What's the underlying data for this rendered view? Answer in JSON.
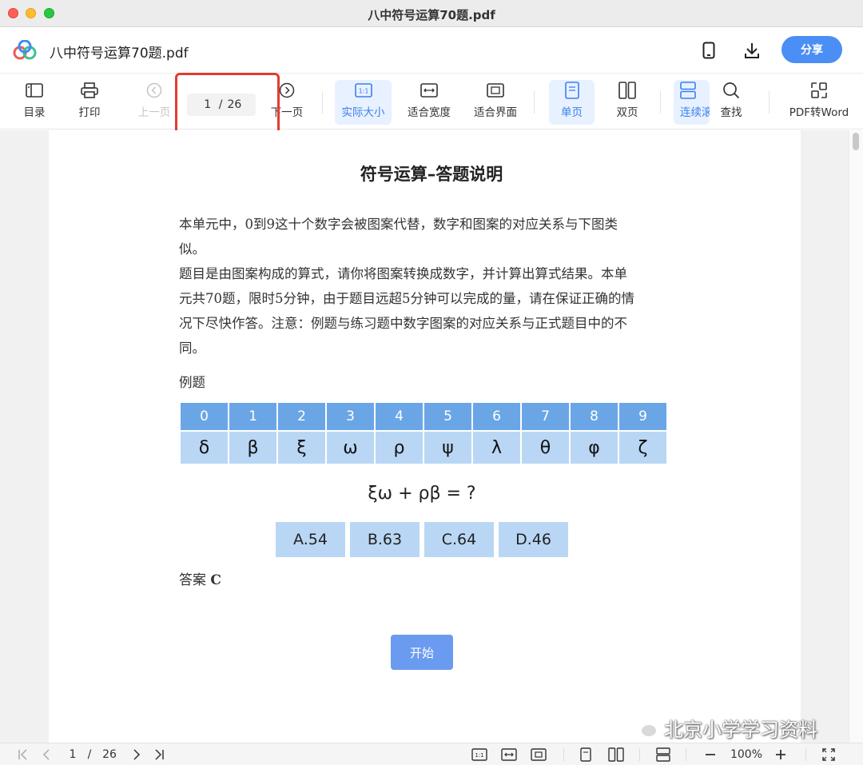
{
  "window": {
    "title": "八中符号运算70题.pdf"
  },
  "app": {
    "doc_title": "八中符号运算70题.pdf",
    "share_label": "分享"
  },
  "toolbar": {
    "toc": "目录",
    "print": "打印",
    "prev_page": "上一页",
    "page_current": "1",
    "page_separator": "/",
    "page_total": "26",
    "next_page": "下一页",
    "actual_size": "实际大小",
    "fit_width": "适合宽度",
    "fit_page": "适合界面",
    "single_page": "单页",
    "double_page": "双页",
    "continuous": "连续滚",
    "find": "查找",
    "pdf_to_word": "PDF转Word"
  },
  "document": {
    "heading": "符号运算–答题说明",
    "paragraph_lines": [
      "本单元中，0到9这十个数字会被图案代替，数字和图案的对应关系与下图类",
      "似。",
      "题目是由图案构成的算式，请你将图案转换成数字，并计算出算式结果。本单",
      "元共70题，限时5分钟，由于题目远超5分钟可以完成的量，请在保证正确的情",
      "况下尽快作答。注意：例题与练习题中数字图案的对应关系与正式题目中的不",
      "同。"
    ],
    "example_label": "例题",
    "digits": [
      "0",
      "1",
      "2",
      "3",
      "4",
      "5",
      "6",
      "7",
      "8",
      "9"
    ],
    "symbols": [
      "δ",
      "β",
      "ξ",
      "ω",
      "ρ",
      "ψ",
      "λ",
      "θ",
      "φ",
      "ζ"
    ],
    "formula": "ξω + ρβ = ?",
    "options": [
      "A.54",
      "B.63",
      "C.64",
      "D.46"
    ],
    "answer_prefix": "答案",
    "answer_value": "C",
    "start_button": "开始",
    "watermark": "北京小学学习资料"
  },
  "statusbar": {
    "page_current": "1",
    "page_separator": "/",
    "page_total": "26",
    "zoom": "100%"
  },
  "colors": {
    "accent": "#4b8ef5",
    "highlight_box": "#e23b33",
    "table_header": "#6aa6e6",
    "table_cell": "#b9d7f4"
  }
}
